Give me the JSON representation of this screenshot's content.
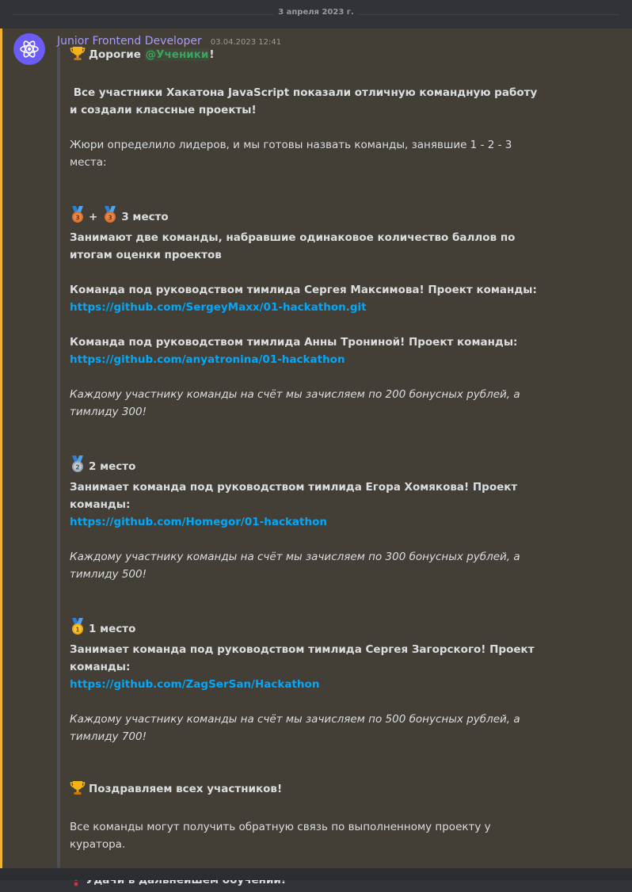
{
  "date_divider": "3 апреля 2023 г.",
  "message": {
    "author": "Junior Frontend Developer",
    "timestamp": "03.04.2023 12:41",
    "avatar_icon": "react-atom-icon",
    "accent_color": "#f0b232",
    "greeting_prefix": "Дорогие ",
    "greeting_mention": "@Ученики",
    "greeting_suffix": "!",
    "intro": " Все участники Хакатона JavaScript показали отличную командную работу и создали классные проекты!",
    "jury": "Жюри определило лидеров, и мы готовы назвать команды, занявшие 1 - 2 - 3 места:",
    "third": {
      "plus": "+",
      "place": "3 место",
      "desc": "Занимают две команды, набравшие одинаковое количество баллов по итогам оценки проектов",
      "team1": "Команда под руководством тимлида Сергея Максимова! Проект команды:",
      "link1": "https://github.com/SergeyMaxx/01-hackathon.git",
      "team2": "Команда под руководством тимлида Анны Трониной! Проект команды:",
      "link2": "https://github.com/anyatronina/01-hackathon",
      "bonus": "Каждому участнику команды на счёт мы зачисляем по 200 бонусных рублей, а тимлиду 300!"
    },
    "second": {
      "place": "2 место",
      "team": "Занимает команда под руководством тимлида Егора Хомякова! Проект команды:",
      "link": "https://github.com/Homegor/01-hackathon",
      "bonus": "Каждому участнику команды на счёт мы зачисляем по 300 бонусных рублей, а тимлиду 500!"
    },
    "first": {
      "place": "1 место",
      "team": "Занимает команда под руководством тимлида Сергея Загорского! Проект команды:",
      "link": "https://github.com/ZagSerSan/Hackathon",
      "bonus": "Каждому участнику команды на счёт мы зачисляем по 500 бонусных рублей, а тимлиду 700!"
    },
    "congrats": "Поздравляем всех участников!",
    "feedback": "Все команды могут получить обратную связь по выполненному проекту у куратора.",
    "wish": "Удачи в дальнейшем обучении!"
  }
}
